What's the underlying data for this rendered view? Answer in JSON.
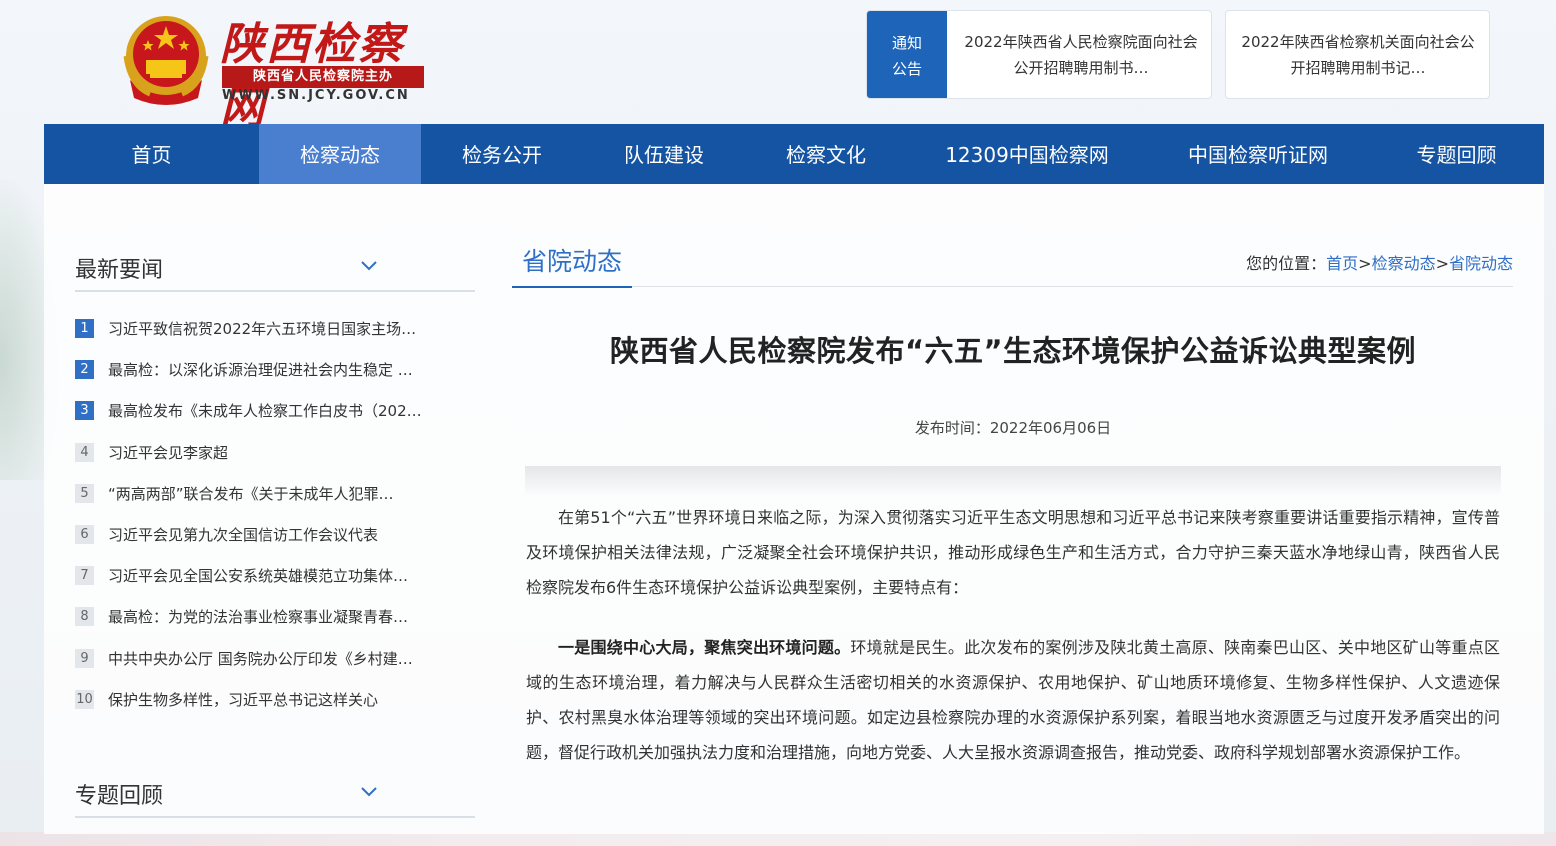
{
  "header": {
    "logo_title": "陕西检察网",
    "logo_sub": "陕西省人民检察院主办",
    "logo_url": "WWW.SN.JCY.GOV.CN",
    "notice_tag_line1": "通知",
    "notice_tag_line2": "公告",
    "notice1": "2022年陕西省人民检察院面向社会公开招聘聘用制书…",
    "notice2": "2022年陕西省检察机关面向社会公开招聘聘用制书记…"
  },
  "nav": {
    "items": [
      "首页",
      "检察动态",
      "检务公开",
      "队伍建设",
      "检察文化",
      "12309中国检察网",
      "中国检察听证网",
      "专题回顾"
    ],
    "active_index": 1
  },
  "sidebar": {
    "latest_title": "最新要闻",
    "topics_title": "专题回顾",
    "news": [
      {
        "num": "1",
        "text": "习近平致信祝贺2022年六五环境日国家主场…"
      },
      {
        "num": "2",
        "text": "最高检：以深化诉源治理促进社会内生稳定 …"
      },
      {
        "num": "3",
        "text": "最高检发布《未成年人检察工作白皮书（202…"
      },
      {
        "num": "4",
        "text": "习近平会见李家超"
      },
      {
        "num": "5",
        "text": "“两高两部”联合发布《关于未成年人犯罪…"
      },
      {
        "num": "6",
        "text": "习近平会见第九次全国信访工作会议代表"
      },
      {
        "num": "7",
        "text": "习近平会见全国公安系统英雄模范立功集体…"
      },
      {
        "num": "8",
        "text": "最高检：为党的法治事业检察事业凝聚青春…"
      },
      {
        "num": "9",
        "text": "中共中央办公厅 国务院办公厅印发《乡村建…"
      },
      {
        "num": "10",
        "text": "保护生物多样性，习近平总书记这样关心"
      }
    ]
  },
  "main": {
    "section_title": "省院动态",
    "breadcrumb_label": "您的位置：",
    "breadcrumb_home": "首页",
    "breadcrumb_sep1": ">",
    "breadcrumb_l2": "检察动态",
    "breadcrumb_sep2": ">",
    "breadcrumb_l3": "省院动态",
    "title": "陕西省人民检察院发布“六五”生态环境保护公益诉讼典型案例",
    "pub_time": "发布时间：2022年06月06日",
    "para1": "在第51个“六五”世界环境日来临之际，为深入贯彻落实习近平生态文明思想和习近平总书记来陕考察重要讲话重要指示精神，宣传普及环境保护相关法律法规，广泛凝聚全社会环境保护共识，推动形成绿色生产和生活方式，合力守护三秦天蓝水净地绿山青，陕西省人民检察院发布6件生态环境保护公益诉讼典型案例，主要特点有：",
    "para2_bold": "一是围绕中心大局，聚焦突出环境问题。",
    "para2": "环境就是民生。此次发布的案例涉及陕北黄土高原、陕南秦巴山区、关中地区矿山等重点区域的生态环境治理，着力解决与人民群众生活密切相关的水资源保护、农用地保护、矿山地质环境修复、生物多样性保护、人文遗迹保护、农村黑臭水体治理等领域的突出环境问题。如定边县检察院办理的水资源保护系列案，着眼当地水资源匮乏与过度开发矛盾突出的问题，督促行政机关加强执法力度和治理措施，向地方党委、人大呈报水资源调查报告，推动党委、政府科学规划部署水资源保护工作。"
  },
  "colors": {
    "nav_bg": "#1454a2",
    "nav_active": "#4a7fcf",
    "accent": "#2f6fc6",
    "brand_red": "#c21818"
  }
}
